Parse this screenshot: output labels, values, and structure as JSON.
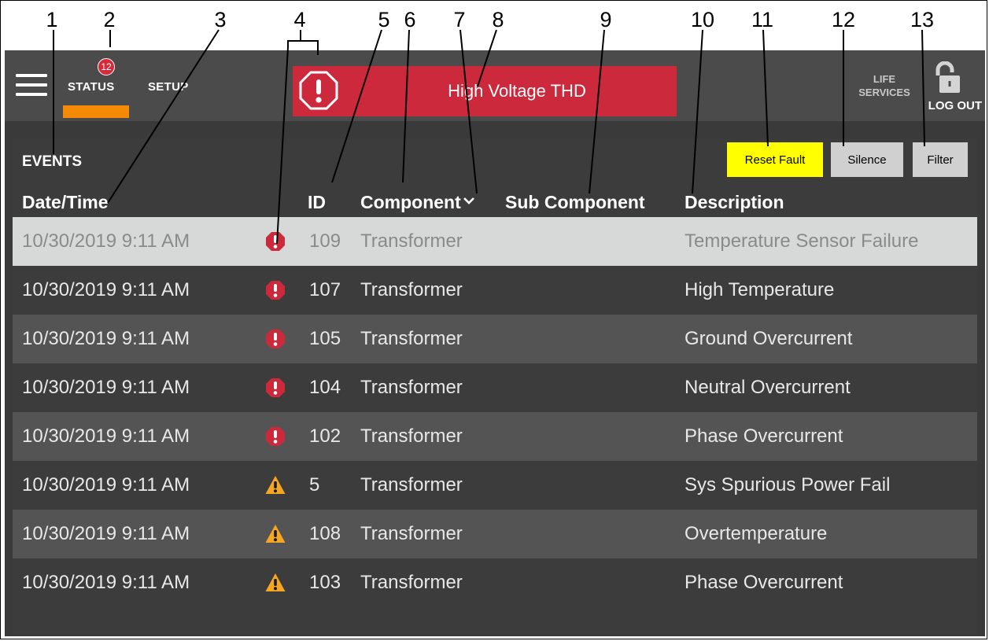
{
  "callouts": [
    "1",
    "2",
    "3",
    "4",
    "5",
    "6",
    "7",
    "8",
    "9",
    "10",
    "11",
    "12",
    "13"
  ],
  "header": {
    "status_badge_count": "12",
    "tabs": [
      {
        "label": "STATUS",
        "active": true
      },
      {
        "label": "SETUP",
        "active": false
      }
    ],
    "alarm_banner": {
      "text": "High Voltage THD",
      "color": "#cc2a3c",
      "icon": "alert-octagon-icon"
    },
    "life_services_line1": "LIFE",
    "life_services_line2": "SERVICES",
    "logout_label": "LOG OUT"
  },
  "events": {
    "title": "EVENTS",
    "buttons": {
      "reset_fault": "Reset Fault",
      "silence": "Silence",
      "filter": "Filter"
    },
    "columns": {
      "date_time": "Date/Time",
      "id": "ID",
      "component": "Component",
      "sub_component": "Sub Component",
      "description": "Description"
    },
    "rows": [
      {
        "date_time": "10/30/2019 9:11 AM",
        "severity": "alarm",
        "id": "109",
        "component": "Transformer",
        "sub_component": "",
        "description": "Temperature Sensor Failure",
        "selected": true
      },
      {
        "date_time": "10/30/2019 9:11 AM",
        "severity": "alarm",
        "id": "107",
        "component": "Transformer",
        "sub_component": "",
        "description": "High Temperature"
      },
      {
        "date_time": "10/30/2019 9:11 AM",
        "severity": "alarm",
        "id": "105",
        "component": "Transformer",
        "sub_component": "",
        "description": "Ground Overcurrent"
      },
      {
        "date_time": "10/30/2019 9:11 AM",
        "severity": "alarm",
        "id": "104",
        "component": "Transformer",
        "sub_component": "",
        "description": "Neutral Overcurrent"
      },
      {
        "date_time": "10/30/2019 9:11 AM",
        "severity": "alarm",
        "id": "102",
        "component": "Transformer",
        "sub_component": "",
        "description": "Phase Overcurrent"
      },
      {
        "date_time": "10/30/2019 9:11 AM",
        "severity": "warning",
        "id": "5",
        "component": "Transformer",
        "sub_component": "",
        "description": "Sys Spurious Power Fail"
      },
      {
        "date_time": "10/30/2019 9:11 AM",
        "severity": "warning",
        "id": "108",
        "component": "Transformer",
        "sub_component": "",
        "description": "Overtemperature"
      },
      {
        "date_time": "10/30/2019 9:11 AM",
        "severity": "warning",
        "id": "103",
        "component": "Transformer",
        "sub_component": "",
        "description": "Phase Overcurrent"
      }
    ]
  },
  "colors": {
    "header_bg": "#4b4b4b",
    "panel_bg": "#3c3c3c",
    "alarm_red": "#cc2a3c",
    "warning_amber": "#f5a623",
    "status_underline": "#f58a07",
    "reset_button": "#ffff00"
  }
}
